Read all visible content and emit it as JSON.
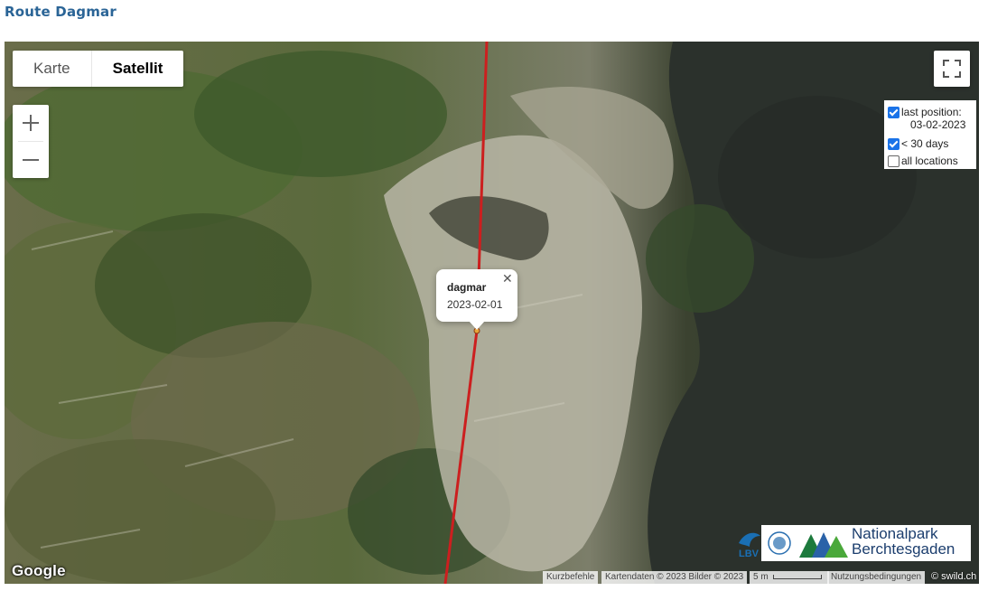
{
  "page_title": "Route Dagmar",
  "map_type": {
    "map_label": "Karte",
    "satellite_label": "Satellit",
    "active": "Satellit"
  },
  "zoom": {
    "in_icon": "plus-icon",
    "out_icon": "minus-icon"
  },
  "fullscreen_icon": "fullscreen-icon",
  "legend": {
    "last_position_label": "last position:",
    "last_position_date": "03-02-2023",
    "last_position_checked": true,
    "days_label": "< 30 days",
    "days_checked": true,
    "all_label": "all locations",
    "all_checked": false
  },
  "info_window": {
    "name": "dagmar",
    "date": "2023-02-01",
    "close_icon": "close-icon"
  },
  "route_color": "#cc1f1f",
  "logos": {
    "lbv": "LBV",
    "np_line1": "Nationalpark",
    "np_line2": "Berchtesgaden"
  },
  "google_logo": "Google",
  "attribution": {
    "shortcuts": "Kurzbefehle",
    "map_data": "Kartendaten © 2023 Bilder © 2023",
    "scale": "5 m",
    "terms": "Nutzungsbedingungen",
    "source": "© swild.ch"
  }
}
